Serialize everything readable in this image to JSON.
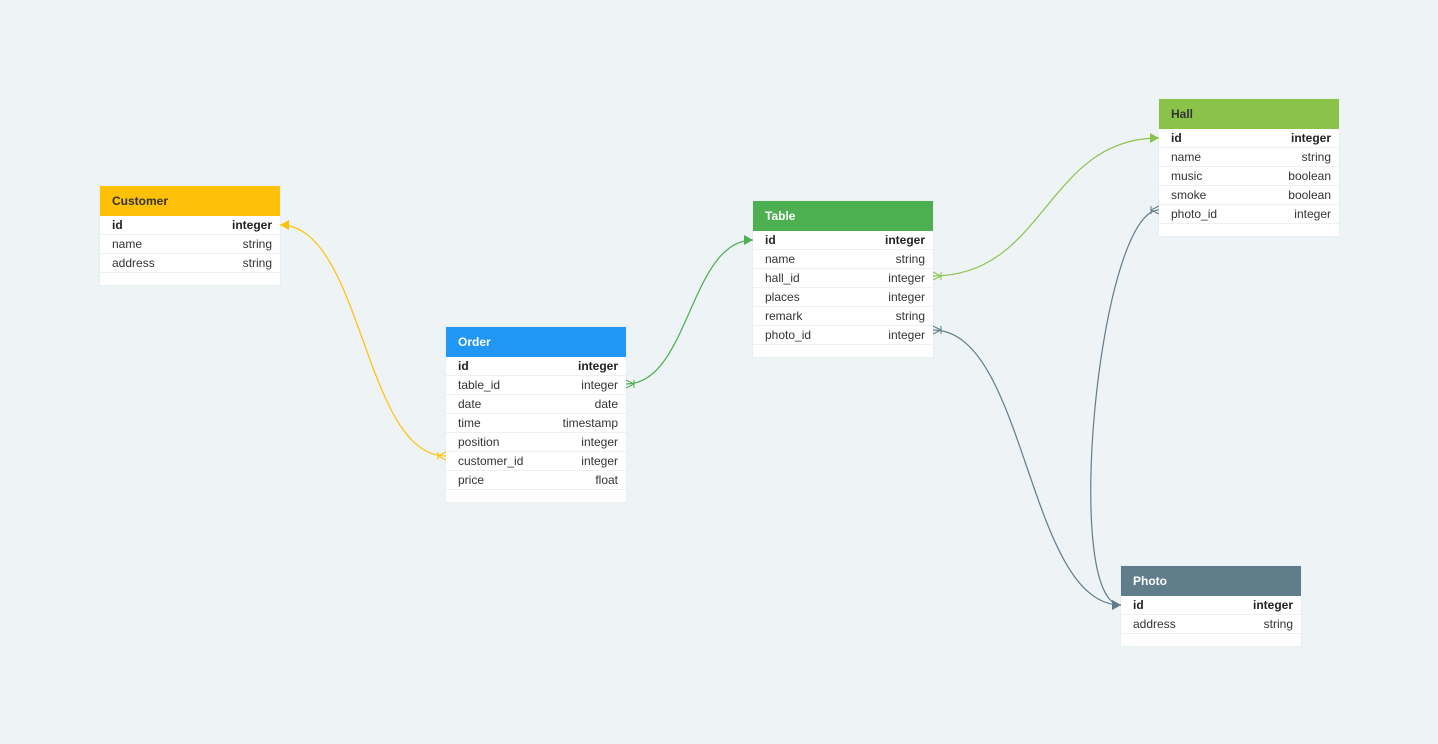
{
  "entities": [
    {
      "key": "customer",
      "name": "Customer",
      "color": "#ffc107",
      "dark_title": true,
      "fields": [
        {
          "name": "id",
          "type": "integer",
          "pk": true
        },
        {
          "name": "name",
          "type": "string"
        },
        {
          "name": "address",
          "type": "string"
        }
      ]
    },
    {
      "key": "order",
      "name": "Order",
      "color": "#2196f3",
      "dark_title": false,
      "fields": [
        {
          "name": "id",
          "type": "integer",
          "pk": true
        },
        {
          "name": "table_id",
          "type": "integer"
        },
        {
          "name": "date",
          "type": "date"
        },
        {
          "name": "time",
          "type": "timestamp"
        },
        {
          "name": "position",
          "type": "integer"
        },
        {
          "name": "customer_id",
          "type": "integer"
        },
        {
          "name": "price",
          "type": "float"
        }
      ]
    },
    {
      "key": "table",
      "name": "Table",
      "color": "#4caf50",
      "dark_title": false,
      "fields": [
        {
          "name": "id",
          "type": "integer",
          "pk": true
        },
        {
          "name": "name",
          "type": "string"
        },
        {
          "name": "hall_id",
          "type": "integer"
        },
        {
          "name": "places",
          "type": "integer"
        },
        {
          "name": "remark",
          "type": "string"
        },
        {
          "name": "photo_id",
          "type": "integer"
        }
      ]
    },
    {
      "key": "hall",
      "name": "Hall",
      "color": "#8bc34a",
      "dark_title": true,
      "fields": [
        {
          "name": "id",
          "type": "integer",
          "pk": true
        },
        {
          "name": "name",
          "type": "string"
        },
        {
          "name": "music",
          "type": "boolean"
        },
        {
          "name": "smoke",
          "type": "boolean"
        },
        {
          "name": "photo_id",
          "type": "integer"
        }
      ]
    },
    {
      "key": "photo",
      "name": "Photo",
      "color": "#607d8b",
      "dark_title": false,
      "fields": [
        {
          "name": "id",
          "type": "integer",
          "pk": true
        },
        {
          "name": "address",
          "type": "string"
        }
      ]
    }
  ],
  "relations": [
    {
      "from": "order.customer_id",
      "to": "customer.id",
      "color": "#ffc107"
    },
    {
      "from": "order.table_id",
      "to": "table.id",
      "color": "#4caf50"
    },
    {
      "from": "table.hall_id",
      "to": "hall.id",
      "color": "#8bc34a"
    },
    {
      "from": "table.photo_id",
      "to": "photo.id",
      "color": "#607d8b"
    },
    {
      "from": "hall.photo_id",
      "to": "photo.id",
      "color": "#607d8b"
    }
  ]
}
